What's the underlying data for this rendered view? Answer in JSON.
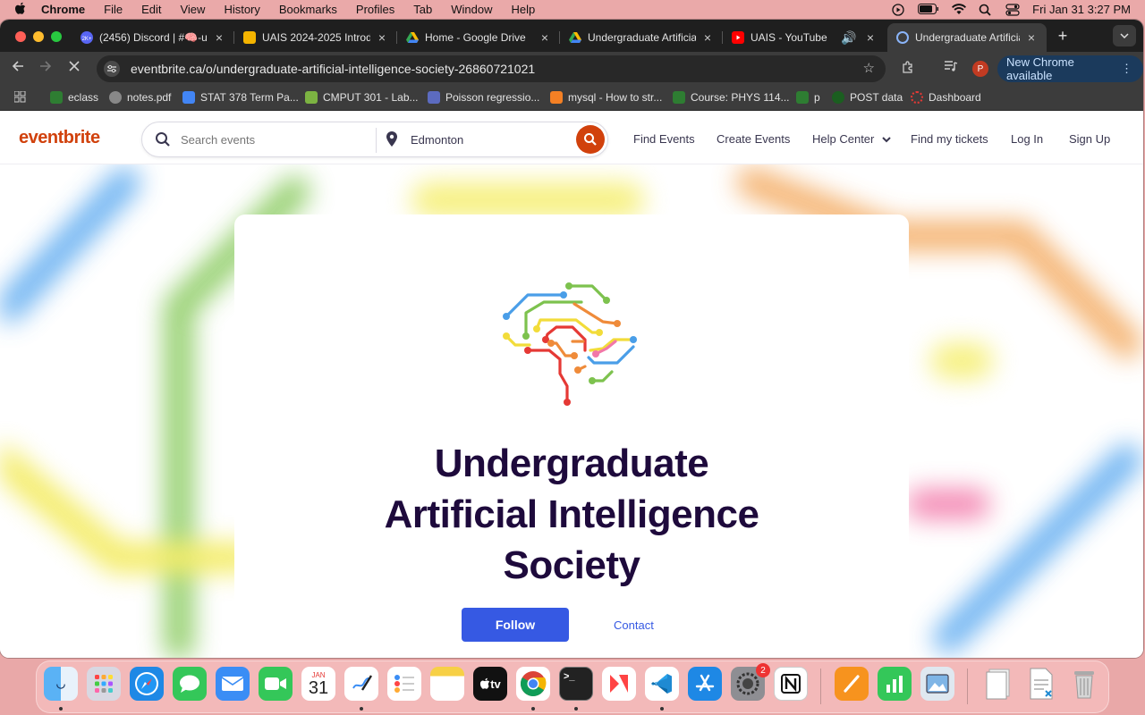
{
  "menubar": {
    "app": "Chrome",
    "items": [
      "File",
      "Edit",
      "View",
      "History",
      "Bookmarks",
      "Profiles",
      "Tab",
      "Window",
      "Help"
    ],
    "datetime": "Fri Jan 31  3:27 PM"
  },
  "tabs": [
    {
      "title": "(2456) Discord | #🧠-u",
      "color": "#5865f2",
      "badge": "2K+"
    },
    {
      "title": "UAIS 2024-2025 Introd",
      "color": "#f4b400"
    },
    {
      "title": "Home - Google Drive",
      "color": "#34a853"
    },
    {
      "title": "Undergraduate Artificia",
      "color": "#34a853"
    },
    {
      "title": "UAIS - YouTube",
      "color": "#ff0000"
    },
    {
      "title": "Undergraduate Artificia",
      "color": "#8ab4f8"
    }
  ],
  "address": {
    "url": "eventbrite.ca/o/undergraduate-artificial-intelligence-society-26860721021"
  },
  "profile_initial": "P",
  "new_chrome": "New Chrome available",
  "bookmarks": [
    "eclass",
    "notes.pdf",
    "STAT 378 Term Pa...",
    "CMPUT 301 - Lab...",
    "Poisson regressio...",
    "mysql - How to str...",
    "Course: PHYS 114...",
    "p",
    "POST data",
    "Dashboard"
  ],
  "site": {
    "logo": "eventbrite",
    "search_placeholder": "Search events",
    "location": "Edmonton",
    "nav": [
      "Find Events",
      "Create Events",
      "Help Center",
      "Find my tickets",
      "Log In",
      "Sign Up"
    ]
  },
  "org": {
    "name_lines": [
      "Undergraduate",
      "Artificial Intelligence",
      "Society"
    ],
    "follow": "Follow",
    "contact": "Contact"
  },
  "dock": {
    "calendar_month": "JAN",
    "calendar_day": "31",
    "settings_badge": "2",
    "tv_label": "tv"
  },
  "colors": {
    "accent": "#d1410c",
    "follow": "#3659e3",
    "title": "#1e0a3c"
  }
}
